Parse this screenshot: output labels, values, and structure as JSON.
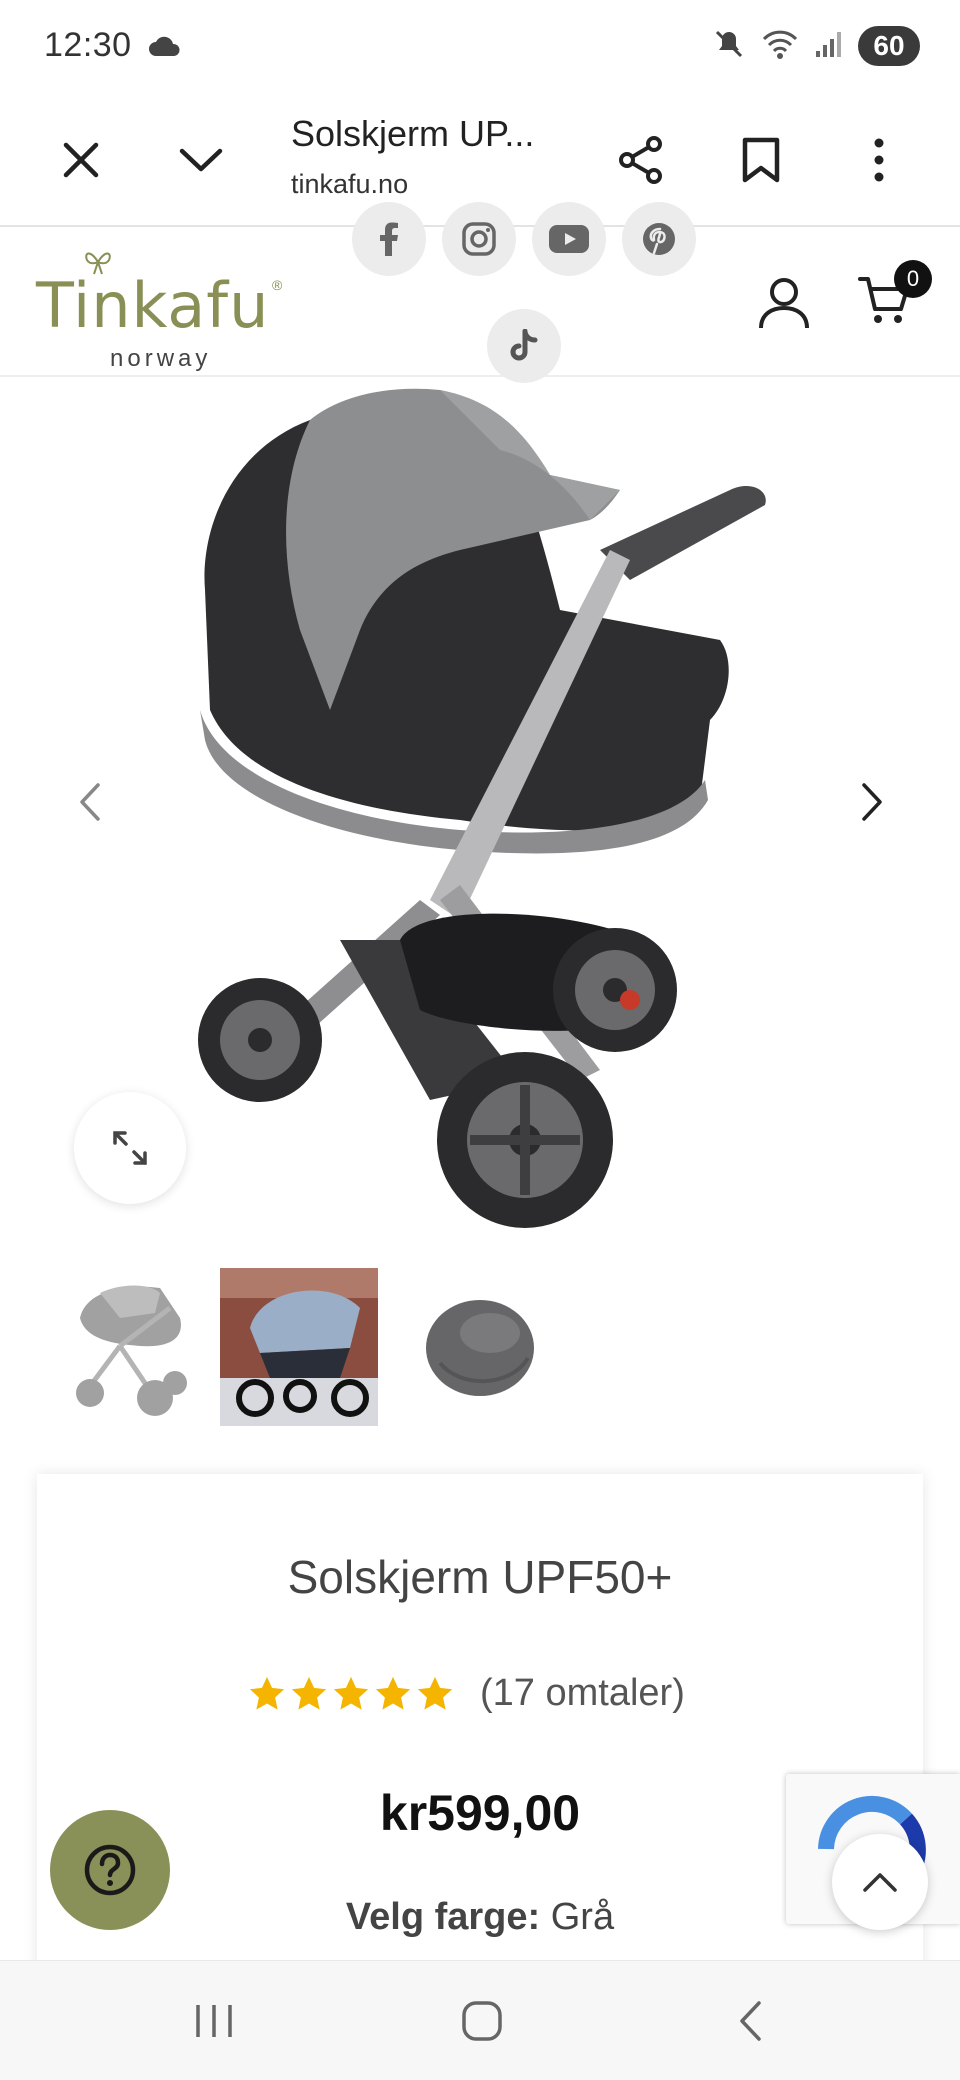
{
  "status_bar": {
    "time": "12:30",
    "battery": "60",
    "icons": [
      "cloud-icon",
      "mute-icon",
      "wifi-icon",
      "signal-icon"
    ]
  },
  "browser": {
    "page_title": "Solskjerm UP...",
    "url": "tinkafu.no",
    "icons": [
      "close-icon",
      "chevron-down-icon",
      "share-icon",
      "bookmark-icon",
      "more-vert-icon"
    ]
  },
  "site": {
    "logo_text": "Tinkafu",
    "logo_sub": "norway",
    "logo_reg": "®",
    "social": [
      "facebook-icon",
      "instagram-icon",
      "youtube-icon",
      "pinterest-icon",
      "tiktok-icon"
    ],
    "cart_count": "0"
  },
  "product": {
    "title": "Solskjerm UPF50+",
    "rating": 5,
    "rating_max": 5,
    "review_count": "(17 omtaler)",
    "price": "kr599,00",
    "color_label": "Velg farge",
    "color_sep": ":",
    "color_value": "Grå",
    "thumbnails": 3,
    "accent_star_color": "#f4b400"
  },
  "colors": {
    "brand_green": "#8a8f55",
    "help_button": "#8a9158"
  }
}
